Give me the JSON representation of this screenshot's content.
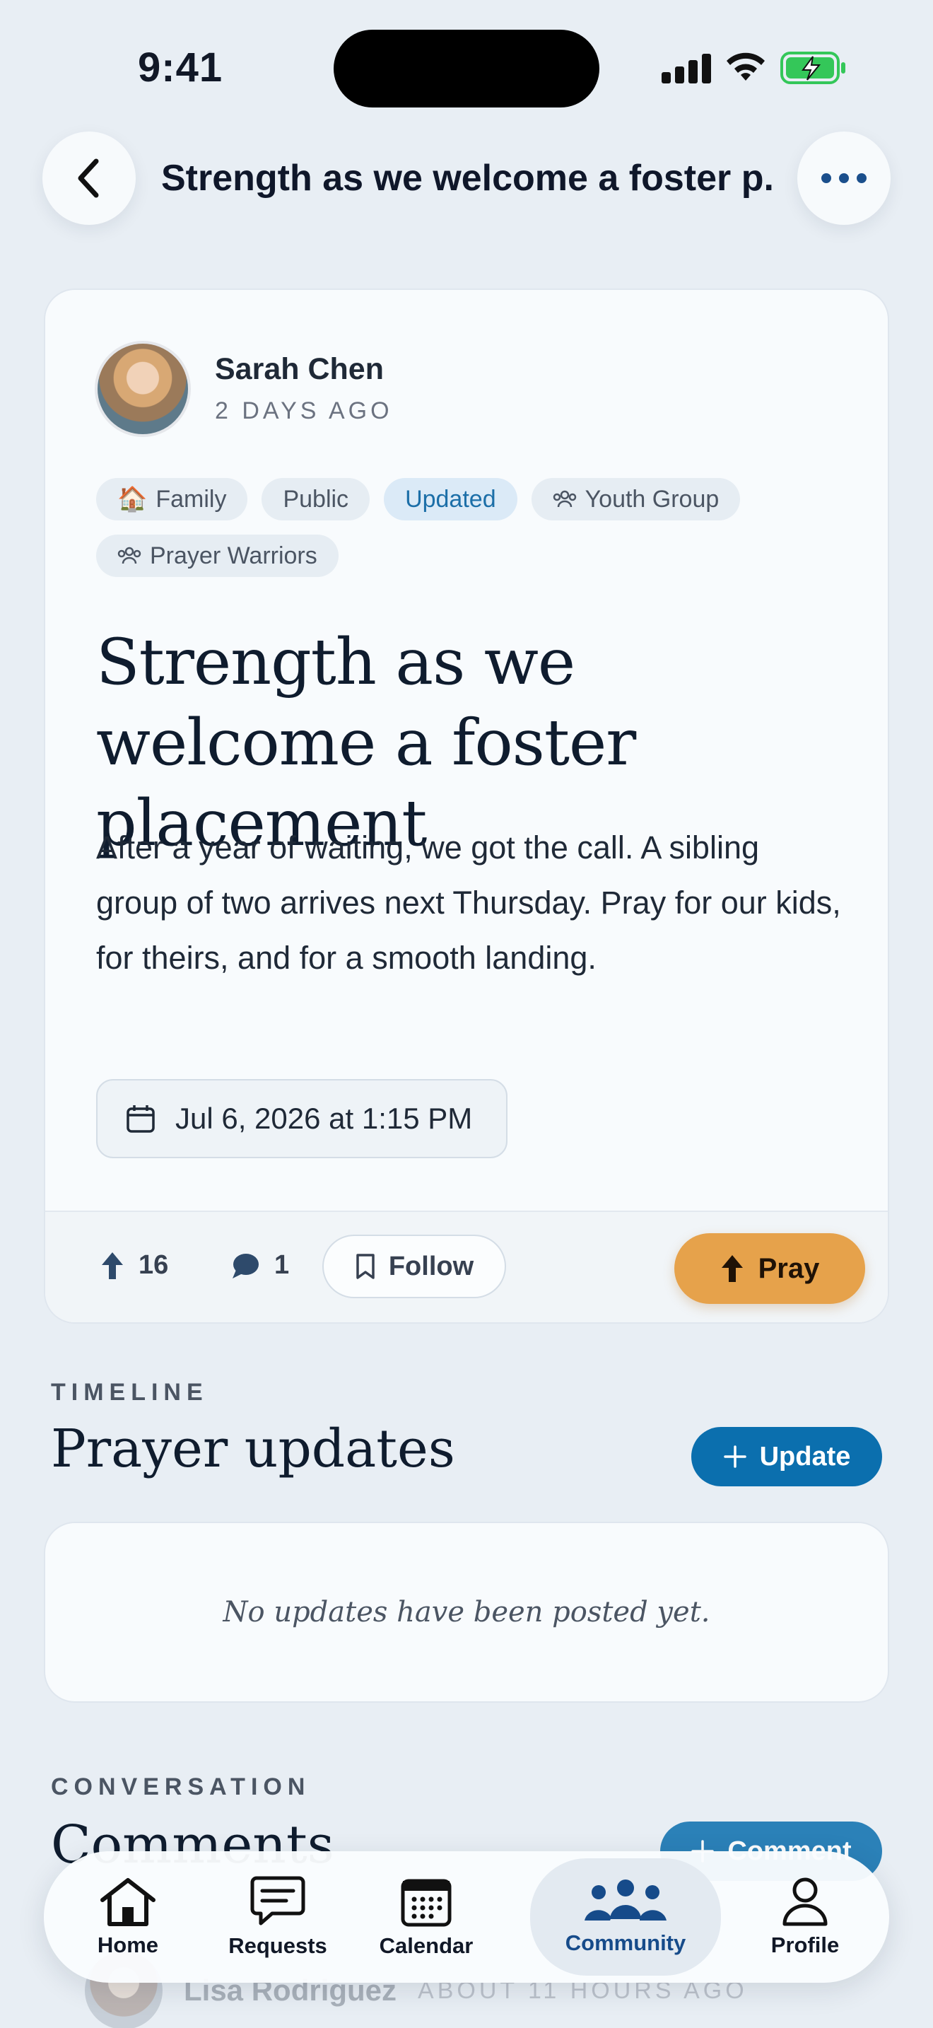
{
  "status_bar": {
    "time": "9:41"
  },
  "header": {
    "title": "Strength as we welcome a foster p..."
  },
  "post": {
    "author": "Sarah Chen",
    "posted_ago": "2 DAYS AGO",
    "tags": [
      {
        "label": "Family",
        "emoji": "🏠"
      },
      {
        "label": "Public"
      },
      {
        "label": "Updated"
      },
      {
        "label": "Youth Group",
        "icon": "group-icon"
      },
      {
        "label": "Prayer Warriors",
        "icon": "group-icon"
      }
    ],
    "title": "Strength as we welcome a foster placement",
    "body": "After a year of waiting, we got the call. A sibling group of two arrives next Thursday. Pray for our kids, for theirs, and for a smooth landing.",
    "date": "Jul 6, 2026 at 1:15 PM",
    "prayer_count": "16",
    "comment_count": "1",
    "follow_label": "Follow",
    "pray_label": "Pray"
  },
  "timeline": {
    "eyebrow": "TIMELINE",
    "title": "Prayer updates",
    "update_button": "Update",
    "empty_text": "No updates have been posted yet."
  },
  "conversation": {
    "eyebrow": "CONVERSATION",
    "title": "Comments",
    "comment_button": "Comment",
    "first_comment_author": "Lisa Rodriguez",
    "first_comment_time": "ABOUT 11 HOURS AGO"
  },
  "tab_bar": {
    "tabs": [
      {
        "label": "Home",
        "icon": "home-icon"
      },
      {
        "label": "Requests",
        "icon": "chat-icon"
      },
      {
        "label": "Calendar",
        "icon": "calendar-icon"
      },
      {
        "label": "Community",
        "icon": "people-icon",
        "active": true
      },
      {
        "label": "Profile",
        "icon": "person-icon"
      }
    ]
  },
  "colors": {
    "accent": "#0b6fae",
    "pray": "#e6a24b",
    "active_tab": "#164b8a",
    "background": "#e8eef4"
  }
}
